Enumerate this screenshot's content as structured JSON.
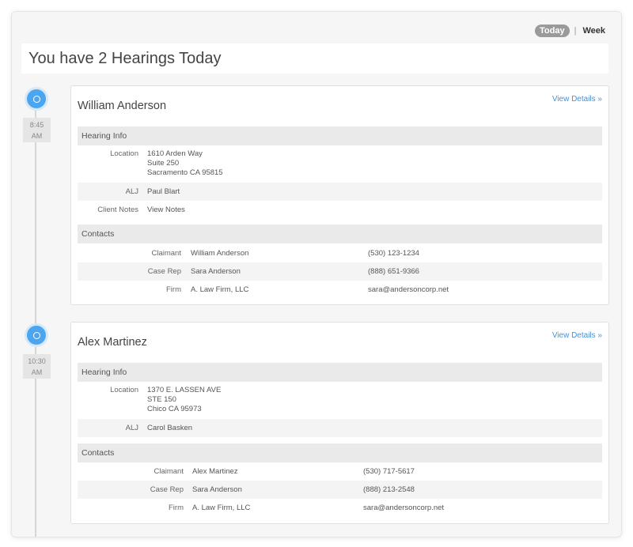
{
  "header": {
    "view_today": "Today",
    "view_separator": "|",
    "view_week": "Week",
    "title": "You have 2 Hearings Today"
  },
  "colors": {
    "accent": "#4ba6ef",
    "link": "#4a8fd6"
  },
  "hearings": [
    {
      "time": "8:45",
      "ampm": "AM",
      "name": "William Anderson",
      "view_details": "View Details »",
      "hearing_info_label": "Hearing Info",
      "location_label": "Location",
      "location": [
        "1610 Arden Way",
        "Suite 250",
        "Sacramento CA 95815"
      ],
      "alj_label": "ALJ",
      "alj": "Paul Blart",
      "client_notes_label": "Client Notes",
      "client_notes_link": "View Notes",
      "contacts_label": "Contacts",
      "contacts": [
        {
          "role": "Claimant",
          "name": "William Anderson",
          "info": "(530) 123-1234"
        },
        {
          "role": "Case Rep",
          "name": "Sara Anderson",
          "info": "(888) 651-9366"
        },
        {
          "role": "Firm",
          "name": "A. Law Firm, LLC",
          "info": "sara@andersoncorp.net"
        }
      ]
    },
    {
      "time": "10:30",
      "ampm": "AM",
      "name": "Alex Martinez",
      "view_details": "View Details »",
      "hearing_info_label": "Hearing Info",
      "location_label": "Location",
      "location": [
        "1370 E. LASSEN AVE",
        "STE 150",
        "Chico CA 95973"
      ],
      "alj_label": "ALJ",
      "alj": "Carol Basken",
      "contacts_label": "Contacts",
      "contacts": [
        {
          "role": "Claimant",
          "name": "Alex Martinez",
          "info": "(530) 717-5617"
        },
        {
          "role": "Case Rep",
          "name": "Sara Anderson",
          "info": "(888) 213-2548"
        },
        {
          "role": "Firm",
          "name": "A. Law Firm, LLC",
          "info": "sara@andersoncorp.net"
        }
      ]
    }
  ]
}
